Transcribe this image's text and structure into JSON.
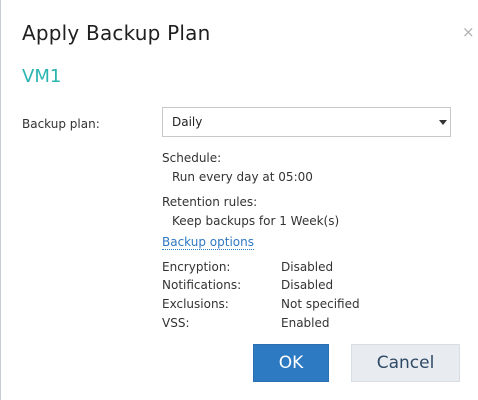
{
  "dialog": {
    "title": "Apply Backup Plan",
    "close_glyph": "×",
    "vm_name": "VM1"
  },
  "backup_plan": {
    "label": "Backup plan:",
    "selected": "Daily"
  },
  "schedule": {
    "label": "Schedule:",
    "value": "Run every day at 05:00"
  },
  "retention": {
    "label": "Retention rules:",
    "value": "Keep backups for 1 Week(s)"
  },
  "backup_options": {
    "link_label": "Backup options",
    "items": [
      {
        "key": "Encryption:",
        "value": "Disabled"
      },
      {
        "key": "Notifications:",
        "value": "Disabled"
      },
      {
        "key": "Exclusions:",
        "value": "Not specified"
      },
      {
        "key": "VSS:",
        "value": "Enabled"
      }
    ]
  },
  "buttons": {
    "ok": "OK",
    "cancel": "Cancel"
  },
  "colors": {
    "accent_teal": "#2bb5b0",
    "link_blue": "#2e78c2",
    "primary_button": "#2e7ac2",
    "secondary_button": "#e8ecf1"
  }
}
